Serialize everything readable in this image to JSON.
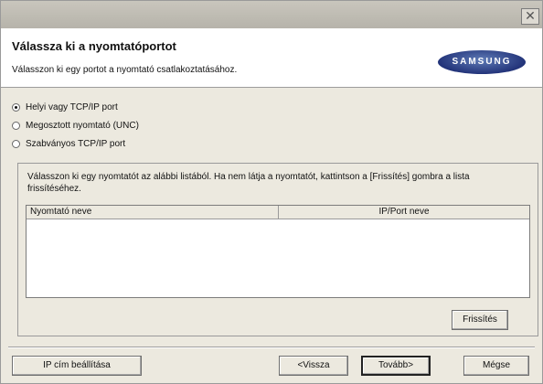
{
  "header": {
    "title": "Válassza ki a nyomtatóportot",
    "subtitle": "Válasszon ki egy portot a nyomtató csatlakoztatásához.",
    "brand": "SAMSUNG"
  },
  "port_options": [
    {
      "label": "Helyi vagy  TCP/IP port",
      "selected": true
    },
    {
      "label": "Megosztott nyomtató (UNC)",
      "selected": false
    },
    {
      "label": "Szabványos TCP/IP port",
      "selected": false
    }
  ],
  "printer_group": {
    "description": "Válasszon ki egy nyomtatót az alábbi listából. Ha nem látja a nyomtatót, kattintson a [Frissítés] gombra a lista frissítéséhez.",
    "columns": [
      "Nyomtató neve",
      "IP/Port neve"
    ],
    "refresh_label": "Frissítés"
  },
  "footer": {
    "ip_settings_label": "IP cím beállítása",
    "back_label": "<Vissza",
    "next_label": "Tovább>",
    "cancel_label": "Mégse"
  },
  "window": {
    "close_glyph": "✕"
  }
}
